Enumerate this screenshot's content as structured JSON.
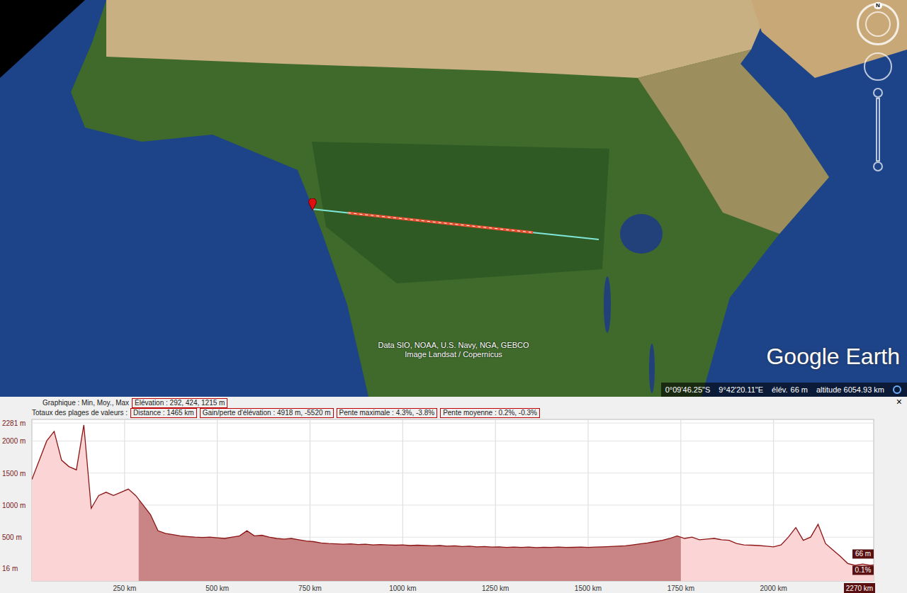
{
  "map": {
    "attribution": [
      "Data SIO, NOAA, U.S. Navy, NGA, GEBCO",
      "Image Landsat / Copernicus"
    ],
    "logo": "Google Earth",
    "compass": "N"
  },
  "status_bar": {
    "latitude": "0°09'46.25\"S",
    "longitude": "9°42'20.11\"E",
    "elevation_label": "élév.",
    "elevation": "66 m",
    "altitude": "altitude 6054.93 km"
  },
  "profile": {
    "close": "×",
    "graph_label": "Graphique : Min, Moy., Max",
    "elevation": "Élévation : 292, 424, 1215 m",
    "totals_label": "Totaux des plages de valeurs :",
    "stats": [
      "Distance : 1465 km",
      "Gain/perte d'élévation : 4918 m, -5520 m",
      "Pente maximale : 4.3%, -3.8%",
      "Pente moyenne : 0.2%, -0.3%"
    ],
    "chart": {
      "total_km": 2270,
      "step_km": 20,
      "selection": {
        "start_km": 288,
        "end_km": 1750
      },
      "y_ticks": [
        {
          "label": "2281 m",
          "value": 2281
        },
        {
          "label": "2000 m",
          "value": 2000
        },
        {
          "label": "1500 m",
          "value": 1500
        },
        {
          "label": "1000 m",
          "value": 1000
        },
        {
          "label": "500 m",
          "value": 500
        },
        {
          "label": "16 m",
          "value": 16
        }
      ],
      "x_ticks": [
        {
          "label": "250 km",
          "value": 250
        },
        {
          "label": "500 km",
          "value": 500
        },
        {
          "label": "750 km",
          "value": 750
        },
        {
          "label": "1000 km",
          "value": 1000
        },
        {
          "label": "1250 km",
          "value": 1250
        },
        {
          "label": "1500 km",
          "value": 1500
        },
        {
          "label": "1750 km",
          "value": 1750
        },
        {
          "label": "2000 km",
          "value": 2000
        }
      ],
      "end_label": "2270 km",
      "marker_elevation": "66 m",
      "marker_slope": "0.1%",
      "elevation_m": [
        1400,
        1700,
        2000,
        2150,
        1700,
        1600,
        1550,
        2250,
        950,
        1150,
        1200,
        1150,
        1200,
        1250,
        1150,
        1000,
        850,
        600,
        560,
        540,
        520,
        510,
        500,
        495,
        500,
        490,
        480,
        500,
        520,
        600,
        520,
        530,
        500,
        480,
        470,
        480,
        460,
        440,
        430,
        410,
        400,
        395,
        390,
        395,
        385,
        390,
        380,
        385,
        380,
        375,
        380,
        370,
        375,
        370,
        365,
        370,
        360,
        365,
        355,
        360,
        350,
        355,
        345,
        350,
        340,
        345,
        340,
        345,
        338,
        342,
        340,
        345,
        340,
        342,
        345,
        340,
        345,
        350,
        355,
        360,
        365,
        380,
        395,
        410,
        430,
        450,
        480,
        520,
        480,
        500,
        460,
        470,
        480,
        460,
        450,
        400,
        380,
        375,
        370,
        360,
        350,
        380,
        500,
        650,
        450,
        500,
        700,
        400,
        300,
        200,
        90,
        60,
        80,
        60,
        66
      ]
    }
  }
}
